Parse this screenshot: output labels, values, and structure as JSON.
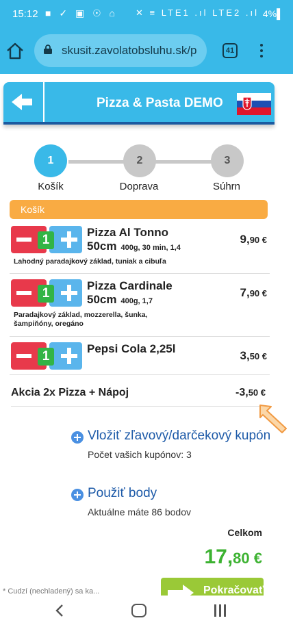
{
  "status_bar": {
    "time": "15:12",
    "left_icons": "■ ✓ ▣ ☉ ⌂",
    "right_icons": "✕ ≡ LTE1 .ıl LTE2 .ıl",
    "battery": "4%"
  },
  "browser": {
    "url": "skusit.zavolatobsluhu.sk/p",
    "tab_count": "41"
  },
  "header": {
    "title": "Pizza & Pasta DEMO"
  },
  "steps": [
    {
      "number": "1",
      "label": "Košík",
      "active": true
    },
    {
      "number": "2",
      "label": "Doprava",
      "active": false
    },
    {
      "number": "3",
      "label": "Súhrn",
      "active": false
    }
  ],
  "cart": {
    "title": "Košík",
    "items": [
      {
        "qty": "1",
        "name": "Pizza Al Tonno",
        "size": "50cm",
        "meta": "400g, 30 min, 1,4",
        "desc": "Lahodný paradajkový základ, tuniak a cibuľa",
        "price_main": "9,",
        "price_cents": "90 €"
      },
      {
        "qty": "1",
        "name": "Pizza Cardinale",
        "size": "50cm",
        "meta": "400g, 1,7",
        "desc": "Paradajkový základ, mozzerella, šunka, šampiňóny, oregáno",
        "price_main": "7,",
        "price_cents": "90 €"
      },
      {
        "qty": "1",
        "name": "Pepsi Cola 2,25l",
        "size": "",
        "meta": "",
        "desc": "",
        "price_main": "3,",
        "price_cents": "50 €"
      }
    ],
    "promo": {
      "label": "Akcia 2x Pizza + Nápoj",
      "price_main": "-3,",
      "price_cents": "50 €"
    }
  },
  "coupon": {
    "label": "Vložiť zľavový/darčekový kupón",
    "sub": "Počet vašich kupónov: 3"
  },
  "points": {
    "label": "Použiť body",
    "sub": "Aktuálne máte 86 bodov"
  },
  "total": {
    "label": "Celkom",
    "main": "17,",
    "cents": "80 €"
  },
  "footer": {
    "left_text": "* Cudzí (nechladený) sa ka...",
    "continue_label": "Pokračovať"
  },
  "colors": {
    "primary": "#39b9e8",
    "accent_orange": "#f9ab43",
    "minus_red": "#e8394b",
    "plus_blue": "#5ab5ec",
    "qty_green": "#32b445",
    "total_green": "#3cb231",
    "step_active": "#39b9e8",
    "step_inactive": "#c8c8c8"
  }
}
